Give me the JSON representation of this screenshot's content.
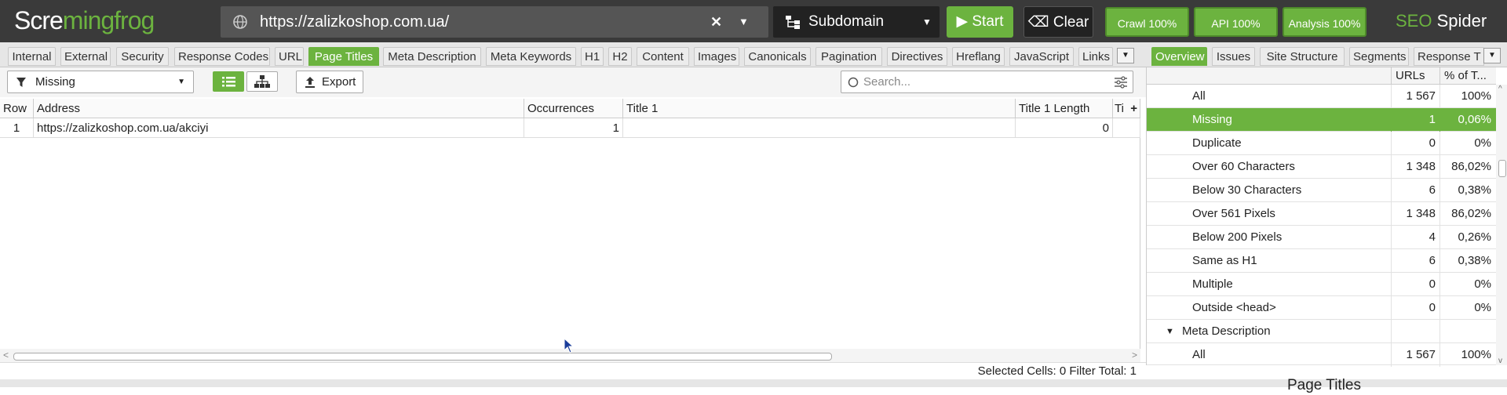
{
  "app": {
    "logo_prefix": "Scre",
    "logo_frog": "mingfrog",
    "seo_label": "SEO",
    "spider_label": " Spider"
  },
  "toolbar": {
    "url_value": "https://zalizkoshop.com.ua/",
    "clear_url_glyph": "✕",
    "url_dropdown_glyph": "▼",
    "mode_label": "Subdomain",
    "start_label": "Start",
    "clear_label": "Clear",
    "crawl_label": "Crawl 100%",
    "api_label": "API 100%",
    "analysis_label": "Analysis 100%",
    "colors": {
      "accent": "#6cb33f",
      "topbar": "#3a3a3a"
    }
  },
  "tabs": {
    "items": [
      "Internal",
      "External",
      "Security",
      "Response Codes",
      "URL",
      "Page Titles",
      "Meta Description",
      "Meta Keywords",
      "H1",
      "H2",
      "Content",
      "Images",
      "Canonicals",
      "Pagination",
      "Directives",
      "Hreflang",
      "JavaScript",
      "Links"
    ],
    "active": "Page Titles",
    "right_items": [
      "Overview",
      "Issues",
      "Site Structure",
      "Segments",
      "Response T"
    ],
    "right_active": "Overview",
    "more_glyph": "▼"
  },
  "filterbar": {
    "filter_value": "Missing",
    "export_label": "Export",
    "search_placeholder": "Search..."
  },
  "grid": {
    "columns": [
      "Row",
      "Address",
      "Occurrences",
      "Title 1",
      "Title 1 Length",
      "Ti"
    ],
    "add_column_glyph": "+",
    "rows": [
      {
        "row": "1",
        "address": "https://zalizkoshop.com.ua/akciyi",
        "occurrences": "1",
        "title1": "",
        "title1_length": "0"
      }
    ]
  },
  "status": {
    "text": "Selected Cells:  0  Filter Total:  1"
  },
  "overview": {
    "col_urls": "URLs",
    "col_pct": "% of T...",
    "rows": [
      {
        "label": "All",
        "urls": "1 567",
        "pct": "100%"
      },
      {
        "label": "Missing",
        "urls": "1",
        "pct": "0,06%"
      },
      {
        "label": "Duplicate",
        "urls": "0",
        "pct": "0%"
      },
      {
        "label": "Over 60 Characters",
        "urls": "1 348",
        "pct": "86,02%"
      },
      {
        "label": "Below 30 Characters",
        "urls": "6",
        "pct": "0,38%"
      },
      {
        "label": "Over 561 Pixels",
        "urls": "1 348",
        "pct": "86,02%"
      },
      {
        "label": "Below 200 Pixels",
        "urls": "4",
        "pct": "0,26%"
      },
      {
        "label": "Same as H1",
        "urls": "6",
        "pct": "0,38%"
      },
      {
        "label": "Multiple",
        "urls": "0",
        "pct": "0%"
      },
      {
        "label": "Outside <head>",
        "urls": "0",
        "pct": "0%"
      }
    ],
    "section_label": "Meta Description",
    "section_glyph": "▼",
    "section_rows": [
      {
        "label": "All",
        "urls": "1 567",
        "pct": "100%"
      }
    ],
    "selected_label": "Missing"
  },
  "bottom_panel_title": "Page Titles"
}
